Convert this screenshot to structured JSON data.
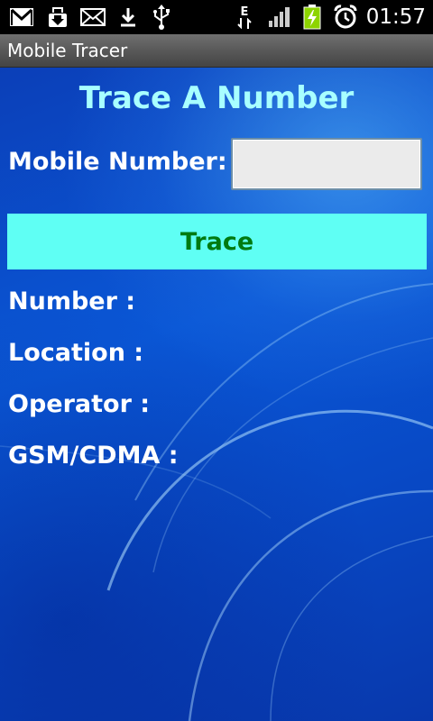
{
  "status_bar": {
    "time": "01:57",
    "network_type": "E",
    "icons": [
      "gmail-icon",
      "download-box-icon",
      "mail-icon",
      "download-icon",
      "usb-icon",
      "edge-data-icon",
      "signal-icon",
      "battery-charging-icon",
      "alarm-icon"
    ]
  },
  "app": {
    "title": "Mobile Tracer"
  },
  "main": {
    "heading": "Trace A Number",
    "mobile_label": "Mobile Number:",
    "mobile_input_value": "",
    "mobile_input_placeholder": "",
    "trace_button": "Trace",
    "results": {
      "number_label": "Number :",
      "location_label": "Location :",
      "operator_label": "Operator :",
      "gsm_label": "GSM/CDMA :"
    }
  },
  "colors": {
    "heading": "#a8ffff",
    "button_bg": "#5ffff4",
    "button_text": "#007a10",
    "background_blue": "#0a57d6"
  }
}
